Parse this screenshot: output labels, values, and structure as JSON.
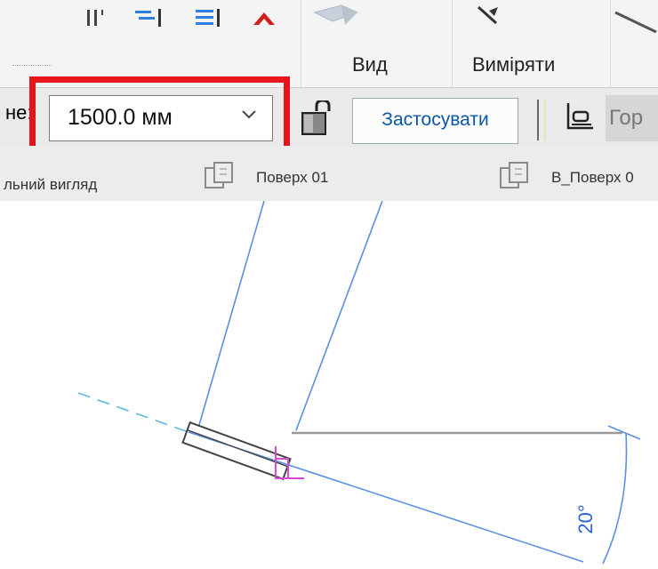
{
  "ribbon": {
    "view_label": "Вид",
    "measure_label": "Виміряти",
    "icons": [
      "align-icon",
      "split-icon",
      "offset-icon",
      "pin-icon",
      "unpin-icon",
      "view-icon",
      "measure-icon",
      "line-icon"
    ]
  },
  "options_bar": {
    "offset_label_fragment": "не:",
    "offset_value": "1500.0 мм",
    "apply_button": "Застосувати",
    "top_bottom_position_fragment": "Гор"
  },
  "view_bar": {
    "view1_fragment": "льний вигляд",
    "view2": "Поверх 01",
    "view3_fragment": "В_Поверх 0"
  },
  "drawing": {
    "angle_dimension": "20°",
    "colors": {
      "reference_lines": "#5b8fe0",
      "work_plane": "#d44ad4",
      "dimension": "#2a61d6",
      "element": "#444444"
    }
  },
  "highlight": {
    "color": "#e8141c",
    "target": "offset_value"
  }
}
